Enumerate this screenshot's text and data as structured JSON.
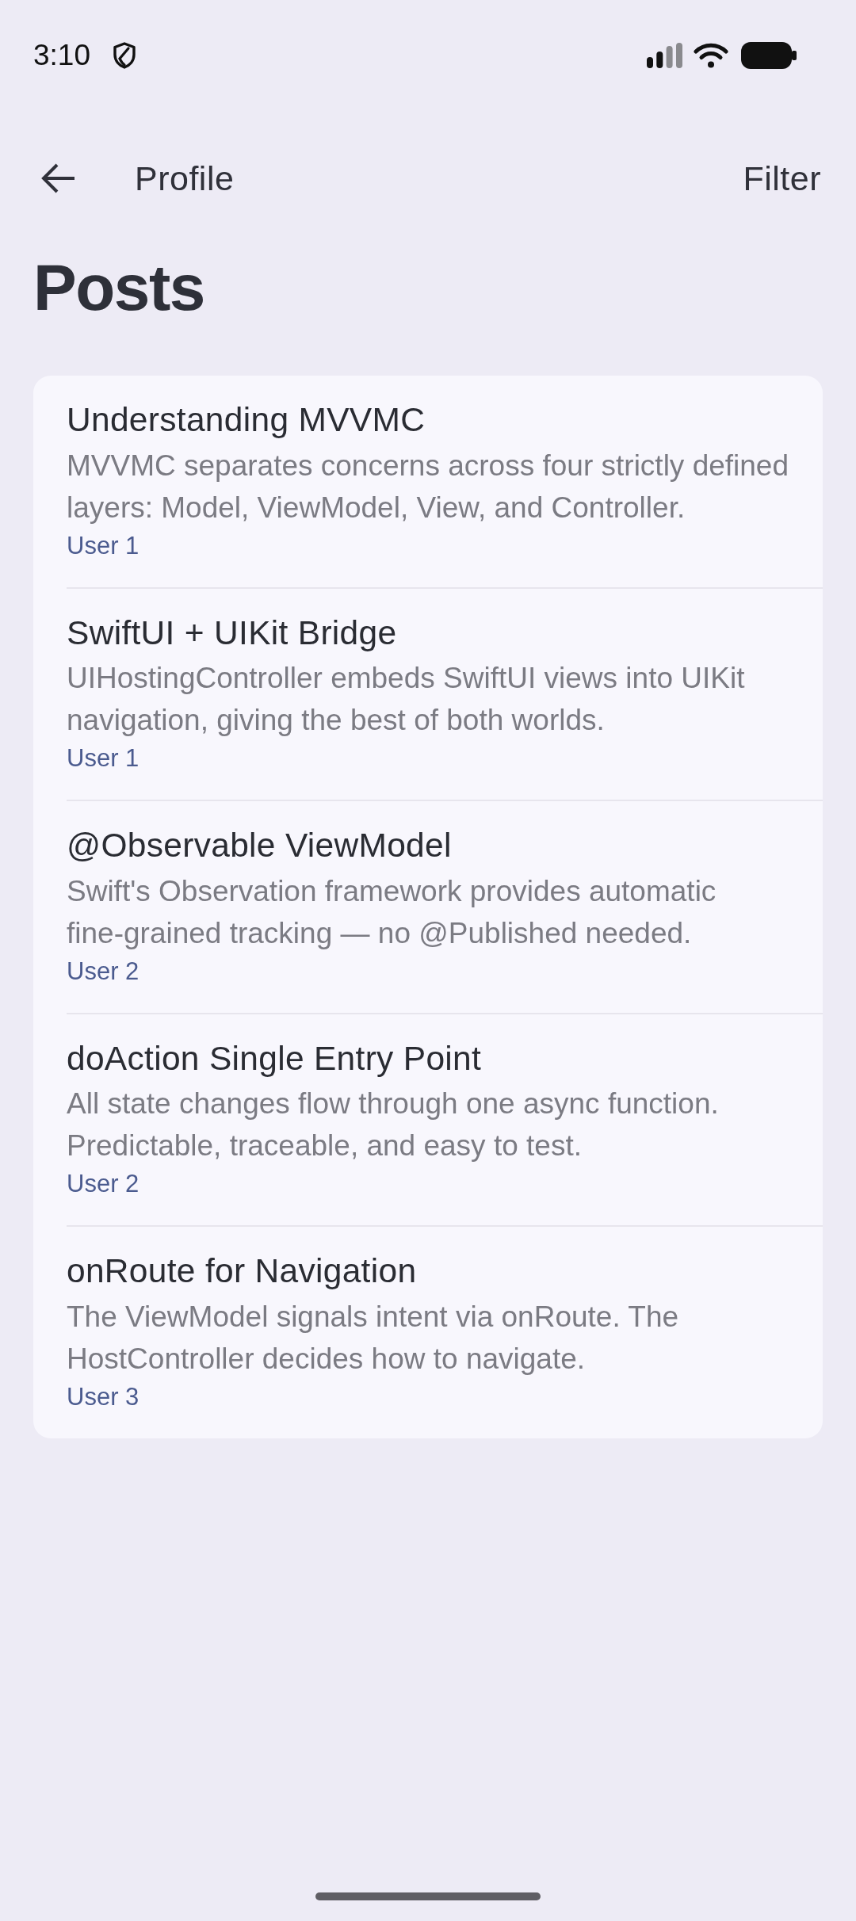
{
  "status_bar": {
    "time": "3:10"
  },
  "toolbar": {
    "title": "Profile",
    "action": "Filter"
  },
  "heading": "Posts",
  "posts": [
    {
      "title": "Understanding MVVMC",
      "excerpt": "MVVMC separates concerns across four strictly defined layers: Model, ViewModel, View, and Controller.",
      "author": "User 1"
    },
    {
      "title": "SwiftUI + UIKit Bridge",
      "excerpt": "UIHostingController embeds SwiftUI views into UIKit navigation, giving the best of both worlds.",
      "author": "User 1"
    },
    {
      "title": "@Observable ViewModel",
      "excerpt": "Swift's Observation framework provides automatic fine-grained tracking — no @Published needed.",
      "author": "User 2"
    },
    {
      "title": "doAction Single Entry Point",
      "excerpt": "All state changes flow through one async function. Predictable, traceable, and easy to test.",
      "author": "User 2"
    },
    {
      "title": "onRoute for Navigation",
      "excerpt": "The ViewModel signals intent via onRoute. The HostController decides how to navigate.",
      "author": "User 3"
    }
  ]
}
